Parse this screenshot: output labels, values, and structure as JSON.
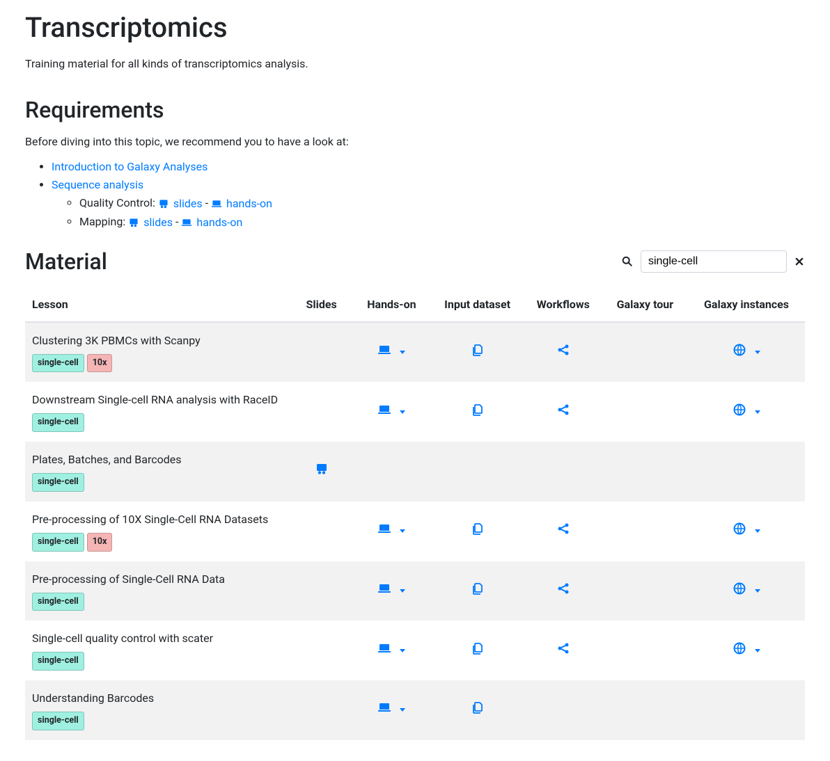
{
  "page": {
    "title": "Transcriptomics",
    "subtitle": "Training material for all kinds of transcriptomics analysis."
  },
  "requirements": {
    "heading": "Requirements",
    "intro": "Before diving into this topic, we recommend you to have a look at:",
    "links": {
      "intro_galaxy": "Introduction to Galaxy Analyses",
      "seq_analysis": "Sequence analysis",
      "quality_control_label": "Quality Control: ",
      "mapping_label": "Mapping: ",
      "slides_label": " slides",
      "handson_label": " hands-on",
      "dash": " - "
    }
  },
  "material": {
    "heading": "Material",
    "search_value": "single-cell",
    "columns": {
      "lesson": "Lesson",
      "slides": "Slides",
      "handson": "Hands-on",
      "input": "Input dataset",
      "workflows": "Workflows",
      "tour": "Galaxy tour",
      "instances": "Galaxy instances"
    },
    "tags": {
      "single_cell": "single-cell",
      "tenx": "10x"
    },
    "rows": [
      {
        "title": "Clustering 3K PBMCs with Scanpy",
        "tags": [
          "single-cell",
          "10x"
        ],
        "slides": false,
        "handson": true,
        "input": true,
        "workflows": true,
        "tour": false,
        "instances": true
      },
      {
        "title": "Downstream Single-cell RNA analysis with RaceID",
        "tags": [
          "single-cell"
        ],
        "slides": false,
        "handson": true,
        "input": true,
        "workflows": true,
        "tour": false,
        "instances": true
      },
      {
        "title": "Plates, Batches, and Barcodes",
        "tags": [
          "single-cell"
        ],
        "slides": true,
        "handson": false,
        "input": false,
        "workflows": false,
        "tour": false,
        "instances": false
      },
      {
        "title": "Pre-processing of 10X Single-Cell RNA Datasets",
        "tags": [
          "single-cell",
          "10x"
        ],
        "slides": false,
        "handson": true,
        "input": true,
        "workflows": true,
        "tour": false,
        "instances": true
      },
      {
        "title": "Pre-processing of Single-Cell RNA Data",
        "tags": [
          "single-cell"
        ],
        "slides": false,
        "handson": true,
        "input": true,
        "workflows": true,
        "tour": false,
        "instances": true
      },
      {
        "title": "Single-cell quality control with scater",
        "tags": [
          "single-cell"
        ],
        "slides": false,
        "handson": true,
        "input": true,
        "workflows": true,
        "tour": false,
        "instances": true
      },
      {
        "title": "Understanding Barcodes",
        "tags": [
          "single-cell"
        ],
        "slides": false,
        "handson": true,
        "input": true,
        "workflows": false,
        "tour": false,
        "instances": false
      }
    ]
  }
}
